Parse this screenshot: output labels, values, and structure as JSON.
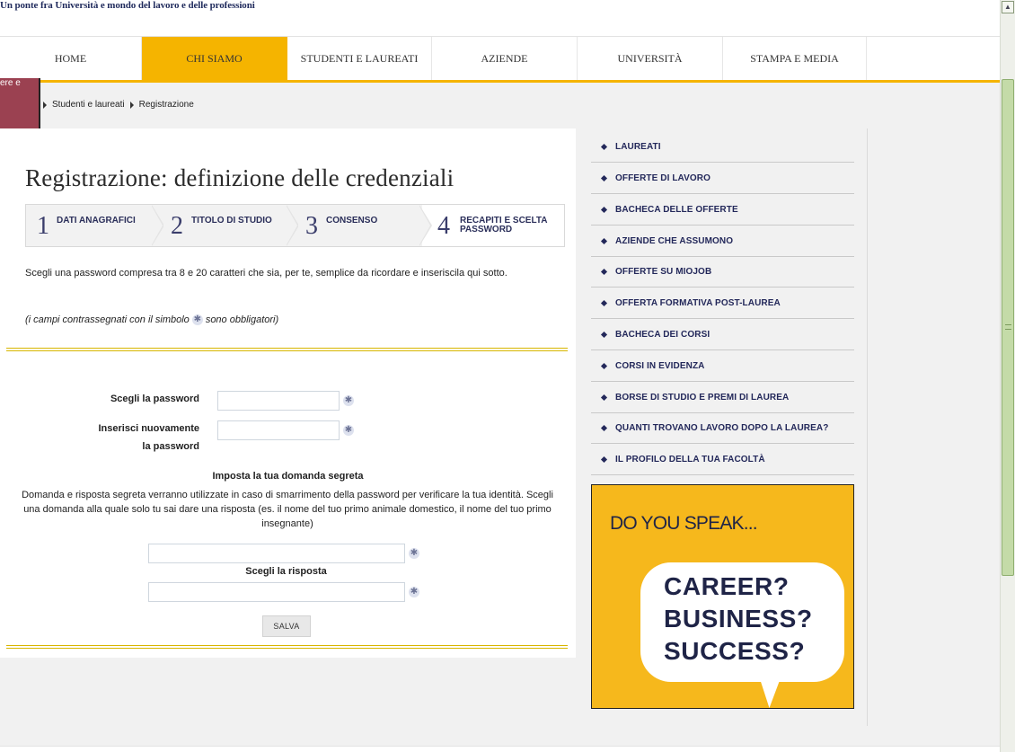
{
  "header": {
    "tagline": "Un ponte fra Università e mondo del lavoro e delle professioni"
  },
  "nav": {
    "items": [
      {
        "label": "HOME",
        "active": false
      },
      {
        "label": "CHI SIAMO",
        "active": true
      },
      {
        "label": "STUDENTI E LAUREATI",
        "active": false
      },
      {
        "label": "AZIENDE",
        "active": false
      },
      {
        "label": "UNIVERSITÀ",
        "active": false
      },
      {
        "label": "STAMPA E MEDIA",
        "active": false
      }
    ]
  },
  "left_tab": {
    "text": "ere e"
  },
  "breadcrumb": {
    "items": [
      "Studenti e laureati",
      "Registrazione"
    ]
  },
  "page": {
    "title": "Registrazione: definizione delle credenziali"
  },
  "steps": [
    {
      "number": "1",
      "label": "DATI ANAGRAFICI",
      "current": false
    },
    {
      "number": "2",
      "label": "TITOLO DI STUDIO",
      "current": false
    },
    {
      "number": "3",
      "label": "CONSENSO",
      "current": false
    },
    {
      "number": "4",
      "label": "RECAPITI E SCELTA PASSWORD",
      "current": true
    }
  ],
  "form": {
    "intro": "Scegli una password compresa tra 8 e 20 caratteri che sia, per te, semplice da ricordare e inseriscila qui sotto.",
    "mandatory_prefix": "(i campi contrassegnati con il simbolo",
    "mandatory_suffix": "sono obbligatori)",
    "required_symbol": "✱",
    "password_label": "Scegli la password",
    "password_value": "",
    "repeat_label_line1": "Inserisci nuovamente",
    "repeat_label_line2": "la password",
    "repeat_value": "",
    "secret_title": "Imposta la tua domanda segreta",
    "secret_desc": "Domanda e risposta segreta verranno utilizzate in caso di smarrimento della password per verificare la tua identità. Scegli una domanda alla quale solo tu sai dare una risposta (es. il nome del tuo primo animale domestico, il nome del tuo primo insegnante)",
    "question_value": "",
    "answer_label": "Scegli la risposta",
    "answer_value": "",
    "save_label": "SALVA"
  },
  "sidebar": {
    "items": [
      "LAUREATI",
      "OFFERTE DI LAVORO",
      "BACHECA DELLE OFFERTE",
      "AZIENDE CHE ASSUMONO",
      "OFFERTE SU MIOJOB",
      "OFFERTA FORMATIVA POST-LAUREA",
      "BACHECA DEI CORSI",
      "CORSI IN EVIDENZA",
      "BORSE DI STUDIO E PREMI DI LAUREA",
      "QUANTI TROVANO LAVORO DOPO LA LAUREA?",
      "IL PROFILO DELLA TUA FACOLTÀ"
    ]
  },
  "banner": {
    "heading": "DO YOU SPEAK...",
    "line1": "CAREER?",
    "line2": "BUSINESS?",
    "line3": "SUCCESS?"
  },
  "colors": {
    "accent": "#f5b400",
    "navy": "#23285a",
    "maroon": "#9b4151"
  }
}
